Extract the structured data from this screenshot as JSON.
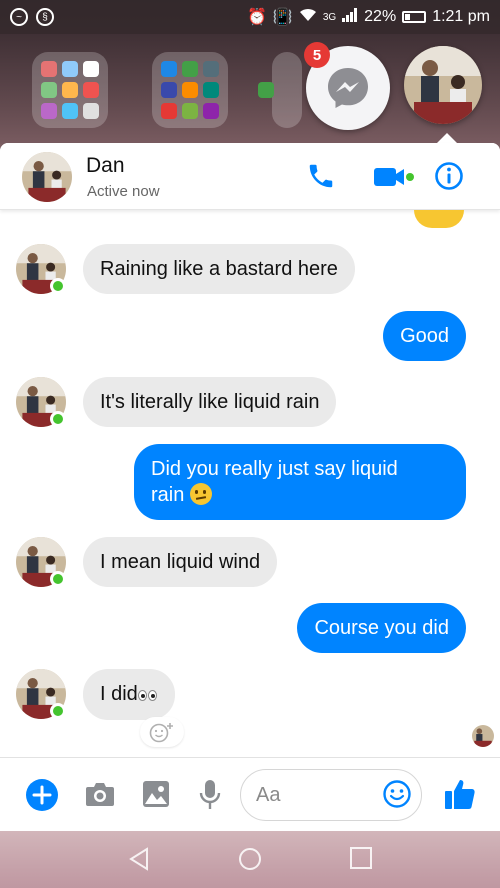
{
  "status_bar": {
    "network": "3G",
    "battery": "22%",
    "time": "1:21 pm"
  },
  "chat_heads": {
    "messenger_badge": "5"
  },
  "header": {
    "contact_name": "Dan",
    "status": "Active now",
    "icons": [
      "phone-icon",
      "video-call-icon",
      "info-icon"
    ]
  },
  "messages": [
    {
      "direction": "incoming",
      "text": "Raining like a bastard here"
    },
    {
      "direction": "outgoing",
      "text": "Good"
    },
    {
      "direction": "incoming",
      "text": "It's literally like liquid rain"
    },
    {
      "direction": "outgoing",
      "text_line1": "Did you really just say liquid",
      "text_line2": "rain",
      "emoji": "confused-face"
    },
    {
      "direction": "incoming",
      "text": "I mean liquid wind"
    },
    {
      "direction": "outgoing",
      "text": "Course you did"
    },
    {
      "direction": "incoming",
      "text": "I did",
      "emoji": "eyes"
    }
  ],
  "composer": {
    "placeholder": "Aa",
    "icons": [
      "add-icon",
      "camera-icon",
      "gallery-icon",
      "microphone-icon",
      "emoji-icon",
      "thumbs-up-icon"
    ]
  },
  "colors": {
    "accent": "#0084ff",
    "incoming_bubble": "#eaeaea",
    "online": "#44c42e",
    "badge": "#e53935"
  }
}
